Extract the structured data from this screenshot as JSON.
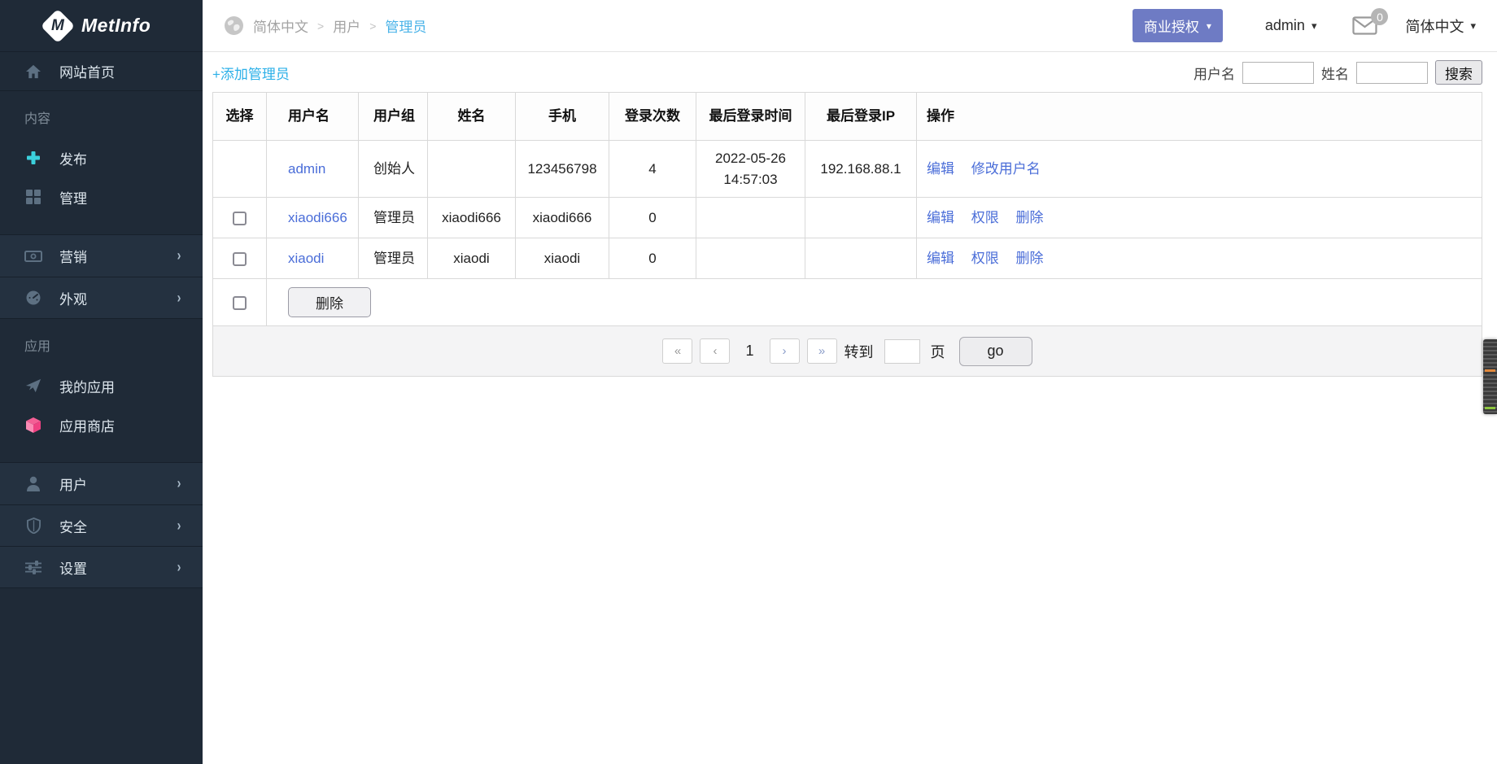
{
  "app": {
    "name": "MetInfo"
  },
  "sidebar": {
    "items": [
      {
        "label": "网站首页",
        "icon": "home-icon"
      },
      {
        "label": "内容",
        "type": "section"
      },
      {
        "label": "发布",
        "icon": "plus-icon"
      },
      {
        "label": "管理",
        "icon": "grid-icon"
      },
      {
        "label": "营销",
        "icon": "banknote-icon",
        "chevron": "›"
      },
      {
        "label": "外观",
        "icon": "gauge-icon",
        "chevron": "›"
      },
      {
        "label": "应用",
        "type": "section"
      },
      {
        "label": "我的应用",
        "icon": "paper-plane-icon"
      },
      {
        "label": "应用商店",
        "icon": "cube-icon"
      },
      {
        "label": "用户",
        "icon": "user-icon",
        "chevron": "›"
      },
      {
        "label": "安全",
        "icon": "shield-icon",
        "chevron": "›"
      },
      {
        "label": "设置",
        "icon": "sliders-icon",
        "chevron": "›"
      }
    ]
  },
  "topbar": {
    "breadcrumb": {
      "lang": "简体中文",
      "section": "用户",
      "current": "管理员",
      "separator": ">"
    },
    "license_button": "商业授权",
    "user_menu": "admin",
    "messages_badge": "0",
    "language_menu": "简体中文",
    "caret": "▾"
  },
  "toolbar": {
    "add_link": "+添加管理员",
    "search": {
      "username_label": "用户名",
      "name_label": "姓名",
      "button": "搜索"
    }
  },
  "table": {
    "headers": [
      "选择",
      "用户名",
      "用户组",
      "姓名",
      "手机",
      "登录次数",
      "最后登录时间",
      "最后登录IP",
      "操作"
    ],
    "rows": [
      {
        "username": "admin",
        "group": "创始人",
        "name": "",
        "phone": "123456798",
        "logins": "4",
        "last_login_time": "2022-05-26 14:57:03",
        "last_login_ip": "192.168.88.1",
        "actions": [
          "编辑",
          "修改用户名"
        ]
      },
      {
        "username": "xiaodi666",
        "group": "管理员",
        "name": "xiaodi666",
        "phone": "xiaodi666",
        "logins": "0",
        "last_login_time": "",
        "last_login_ip": "",
        "actions": [
          "编辑",
          "权限",
          "删除"
        ]
      },
      {
        "username": "xiaodi",
        "group": "管理员",
        "name": "xiaodi",
        "phone": "xiaodi",
        "logins": "0",
        "last_login_time": "",
        "last_login_ip": "",
        "actions": [
          "编辑",
          "权限",
          "删除"
        ]
      }
    ],
    "footer": {
      "delete_button": "删除"
    }
  },
  "pagination": {
    "first": "«",
    "prev": "‹",
    "current": "1",
    "next": "›",
    "last": "»",
    "goto_label": "转到",
    "page_label": "页",
    "go_button": "go"
  },
  "colors": {
    "sidebar_bg": "#1f2a37",
    "accent_purple": "#6e7bc4",
    "link_blue": "#4a6dd8",
    "breadcrumb_active": "#4ab3e8",
    "add_link_cyan": "#2cb0e8",
    "plus_cyan": "#3bd0dc",
    "store_pink": "#f45f95"
  }
}
